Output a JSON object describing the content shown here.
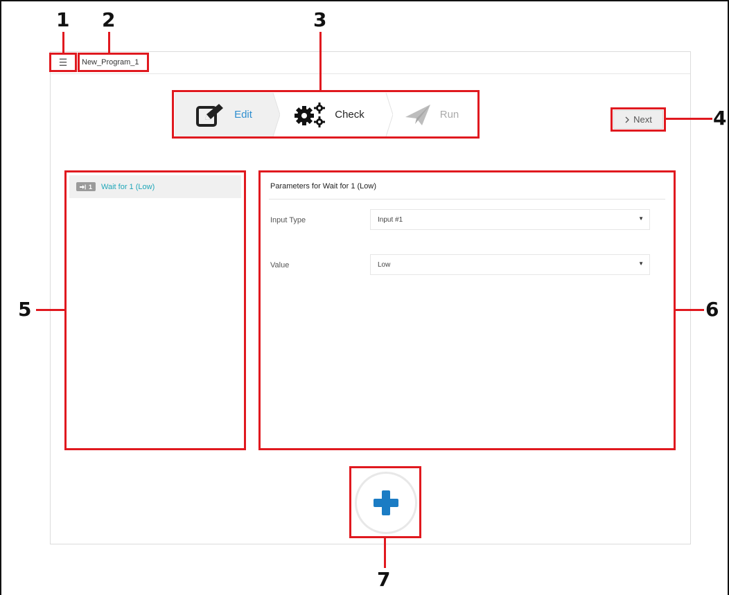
{
  "header": {
    "menu_icon": "☰",
    "program_name": "New_Program_1"
  },
  "wizard": {
    "steps": [
      {
        "label": "Edit",
        "icon": "edit-icon",
        "state": "active"
      },
      {
        "label": "Check",
        "icon": "gears-icon",
        "state": "normal"
      },
      {
        "label": "Run",
        "icon": "paper-plane-icon",
        "state": "disabled"
      }
    ]
  },
  "next_button": {
    "label": "Next",
    "icon": "chevron-right-icon"
  },
  "program_list": {
    "items": [
      {
        "badge_number": "1",
        "badge_icon": "sign-in-icon",
        "label": "Wait for 1 (Low)"
      }
    ]
  },
  "parameters": {
    "title": "Parameters for  Wait for 1 (Low)",
    "fields": [
      {
        "label": "Input Type",
        "value": "Input #1"
      },
      {
        "label": "Value",
        "value": "Low"
      }
    ]
  },
  "add_button": {
    "icon": "plus-icon"
  },
  "callouts": [
    "1",
    "2",
    "3",
    "4",
    "5",
    "6",
    "7"
  ],
  "colors": {
    "highlight": "#e0191f",
    "accent_blue": "#2f8fd0",
    "item_teal": "#1fa6b8",
    "plus_blue": "#1b7cc4"
  }
}
